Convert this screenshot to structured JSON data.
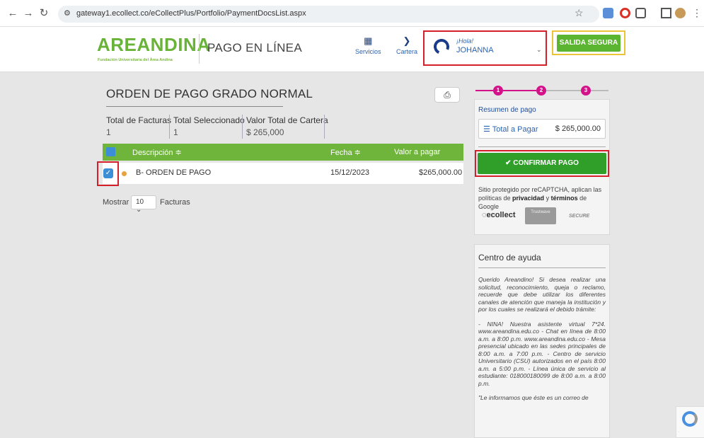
{
  "browser": {
    "url": "gateway1.ecollect.co/eCollectPlus/Portfolio/PaymentDocsList.aspx"
  },
  "header": {
    "logo": "AREANDINA",
    "logo_sub": "Fundación Universitaria del Área Andina",
    "title": "PAGO EN LÍNEA",
    "nav": [
      {
        "label": "Servicios",
        "icon": "grid-icon"
      },
      {
        "label": "Cartera",
        "icon": "chevron-circle-icon"
      }
    ],
    "user": {
      "greeting": "¡Hola!",
      "name": "JOHANNA"
    },
    "logout": "SALIDA SEGURA"
  },
  "order": {
    "title": "ORDEN DE PAGO GRADO NORMAL",
    "summary": [
      {
        "label": "Total de Facturas",
        "value": "1"
      },
      {
        "label": "Total Seleccionado",
        "value": "1"
      },
      {
        "label": "Valor Total de Cartera",
        "value": "$ 265,000"
      }
    ],
    "columns": [
      "Descripción ≑",
      "Fecha ≑",
      "Valor a pagar"
    ],
    "rows": [
      {
        "description": "B- ORDEN DE PAGO",
        "date": "15/12/2023",
        "amount": "$265,000.00",
        "checked": true
      }
    ],
    "show_label": "Mostrar",
    "page_size": "10",
    "facturas_label": "Facturas"
  },
  "steps": [
    "1",
    "2",
    "3"
  ],
  "sidebar": {
    "resumen": "Resumen de pago",
    "total_label": "Total a Pagar",
    "total_value": "$ 265,000.00",
    "confirm": "CONFIRMAR PAGO",
    "captcha_pre": "Sitio protegido por reCAPTCHA, aplican las políticas de ",
    "captcha_priv": "privacidad",
    "captcha_mid": " y ",
    "captcha_terms": "términos",
    "captcha_post": " de Google",
    "badge_ecollect": "ecollect",
    "badge_trust": "Trustwave",
    "badge_secure": "SECURE"
  },
  "help": {
    "title": "Centro de ayuda",
    "paragraphs": [
      "Querido Areandino! Si desea realizar una solicitud, reconocimiento, queja o reclamo, recuerde que debe utilizar los diferentes canales de atención que maneja la institución y por los cuales se realizará el debido trámite:",
      "- NINA! Nuestra asistente virtual 7*24. www.areandina.edu.co - Chat en línea de 8:00 a.m. a 8:00 p.m. www.areandina.edu.co - Mesa presencial ubicado en las sedes principales de 8:00 a.m. a 7:00 p.m. - Centro de servicio Universitario (CSU) autorizados en el país 8:00 a.m. a 5:00 p.m. - Línea única de servicio al estudiante: 018000180099 de 8:00 a.m. a 8:00 p.m.",
      "\"Le informamos que éste es un correo de"
    ]
  },
  "colors": {
    "green": "#6fb43b",
    "confirm": "#2f9f2a",
    "accent_pink": "#d4138a",
    "brand_blue": "#1a3b8c"
  }
}
